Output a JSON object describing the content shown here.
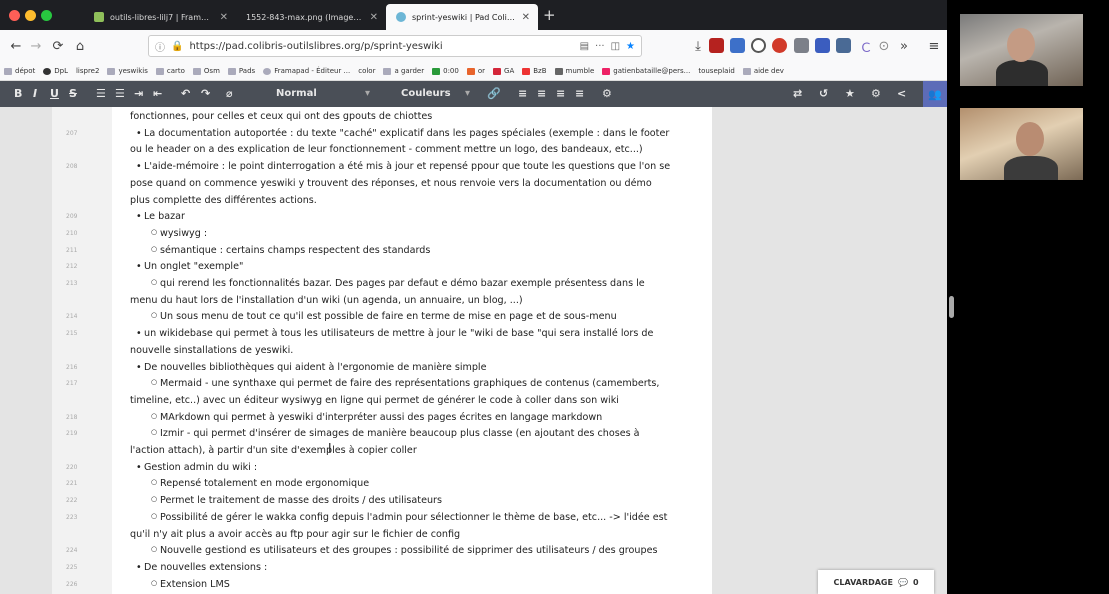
{
  "browser": {
    "tabs": [
      {
        "title": "outils-libres-lilj7 | Framapad",
        "active": false
      },
      {
        "title": "1552-843-max.png (Image PNG,",
        "active": false
      },
      {
        "title": "sprint-yeswiki | Pad Colibris",
        "active": true
      }
    ],
    "url": "https://pad.colibris-outilslibres.org/p/sprint-yeswiki",
    "bookmarks": [
      "dépot",
      "DpL",
      "lispre2",
      "yeswikis",
      "carto",
      "Osm",
      "Pads",
      "Framapad - Éditeur ...",
      "color",
      "a garder",
      "0:00",
      "or",
      "GA",
      "BzB",
      "mumble",
      "gatienbataille@pers...",
      "touseplaid",
      "aide dev"
    ]
  },
  "toolbar": {
    "style_select": "Normal",
    "colors_select": "Couleurs"
  },
  "chat": {
    "label": "CLAVARDAGE",
    "count": "0"
  },
  "doc": {
    "lines": [
      {
        "num": "",
        "level": 0,
        "text": "fonctionnes, pour celles et ceux qui ont des gpouts de chiottes"
      },
      {
        "num": "207",
        "level": 1,
        "text": "La documentation autoportée : du texte \"caché\" explicatif dans les pages spéciales (exemple : dans le footer"
      },
      {
        "num": "",
        "level": 0,
        "text": "ou le header on a des explication de leur fonctionnement - comment mettre un logo, des bandeaux, etc...)"
      },
      {
        "num": "208",
        "level": 1,
        "text": "L'aide-mémoire : le point dinterrogation a été mis à jour et repensé ppour que toute les questions que l'on se"
      },
      {
        "num": "",
        "level": 0,
        "text": "pose quand on commence yeswiki y trouvent des réponses, et nous renvoie vers la documentation ou démo"
      },
      {
        "num": "",
        "level": 0,
        "text": "plus complette des différentes actions."
      },
      {
        "num": "209",
        "level": 1,
        "text": "Le bazar"
      },
      {
        "num": "210",
        "level": 2,
        "text": "wysiwyg :"
      },
      {
        "num": "211",
        "level": 2,
        "text": "sémantique : certains champs respectent des standards"
      },
      {
        "num": "212",
        "level": 1,
        "text": "Un onglet \"exemple\""
      },
      {
        "num": "213",
        "level": 2,
        "text": "qui rerend les fonctionnalités bazar. Des pages par defaut e démo bazar exemple présentess dans le"
      },
      {
        "num": "",
        "level": 0,
        "text": "menu du haut lors de l'installation d'un wiki  (un agenda, un annuaire, un blog, ...)"
      },
      {
        "num": "214",
        "level": 2,
        "text": "Un sous menu de tout ce qu'il est possible de faire en terme de mise en page et de sous-menu"
      },
      {
        "num": "215",
        "level": 1,
        "text": "un wikidebase qui permet à tous les utilisateurs de mettre à jour le \"wiki de base \"qui sera installé lors de"
      },
      {
        "num": "",
        "level": 0,
        "text": "nouvelle sinstallations de yeswiki."
      },
      {
        "num": "216",
        "level": 1,
        "text": "De nouvelles bibliothèques qui aident à l'ergonomie de manière simple"
      },
      {
        "num": "217",
        "level": 2,
        "text": "Mermaid - une synthaxe qui permet de faire des représentations graphiques de contenus (camemberts,"
      },
      {
        "num": "",
        "level": 0,
        "text": "timeline, etc..) avec un éditeur wysiwyg en ligne qui permet de générer le code à coller dans son wiki"
      },
      {
        "num": "218",
        "level": 2,
        "text": "MArkdown qui permet à yeswiki d'interpréter aussi des pages écrites en langage markdown"
      },
      {
        "num": "219",
        "level": 2,
        "text": "Izmir - qui permet d'insérer de simages de manière beaucoup plus classe (en  ajoutant des choses à"
      },
      {
        "num": "",
        "level": 0,
        "text": "l'action attach), à partir d'un site d'exemples à copier coller"
      },
      {
        "num": "220",
        "level": 1,
        "text": "Gestion admin du wiki :"
      },
      {
        "num": "221",
        "level": 2,
        "text": "Repensé totalement en mode ergonomique"
      },
      {
        "num": "222",
        "level": 2,
        "text": "Permet le traitement de masse des droits / des utilisateurs"
      },
      {
        "num": "223",
        "level": 2,
        "text": "Possibilité de gérer le wakka config depuis l'admin pour sélectionner le thème de base, etc... -> l'idée est"
      },
      {
        "num": "",
        "level": 0,
        "text": "qu'il n'y ait plus a avoir accès au ftp pour agir sur le fichier de config"
      },
      {
        "num": "224",
        "level": 2,
        "text": "Nouvelle gestiond es utilisateurs et des groupes : possibilité de sipprimer des utilisateurs / des groupes"
      },
      {
        "num": "225",
        "level": 1,
        "text": "De nouvelles extensions :"
      },
      {
        "num": "226",
        "level": 2,
        "text": "Extension LMS"
      }
    ]
  },
  "icons": {
    "traffic_lights": [
      "#ff5f57",
      "#febc2e",
      "#28c840"
    ],
    "toolbar": [
      "bold-icon",
      "italic-icon",
      "underline-icon",
      "strikethrough-icon",
      "bullet-list-icon",
      "numbered-list-icon",
      "indent-icon",
      "outdent-icon",
      "undo-icon",
      "redo-icon",
      "clear-format-icon",
      "link-icon",
      "align-left-icon",
      "align-center-icon",
      "align-right-icon",
      "justify-icon",
      "settings-icon",
      "history-icon",
      "star-icon",
      "gear-icon",
      "share-icon",
      "users-icon"
    ]
  }
}
